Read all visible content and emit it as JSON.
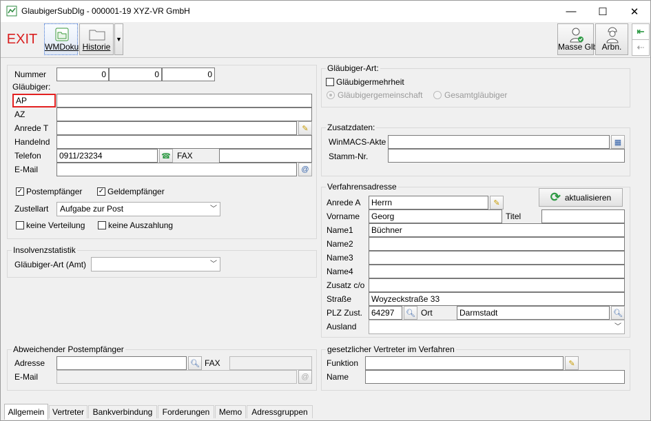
{
  "window": {
    "title": "GlaubigerSubDlg - 000001-19 XYZ-VR GmbH",
    "min": "—",
    "max": "☐",
    "close": "✕"
  },
  "toolbar": {
    "exit": "EXIT",
    "wmdoku": "WMDoku",
    "historie": "Historie",
    "masse": "Masse Glb.",
    "arbn": "Arbn."
  },
  "glaeubiger": {
    "nummer_label": "Nummer",
    "nummer": [
      "0",
      "0",
      "0"
    ],
    "group": "Gläubiger:",
    "ap_label": "AP",
    "az_label": "AZ",
    "anrede_label": "Anrede T",
    "handelnd_label": "Handelnd",
    "telefon_label": "Telefon",
    "telefon": "0911/23234",
    "fax_label": "FAX",
    "email_label": "E-Mail",
    "postempfaenger": "Postempfänger",
    "geldempfaenger": "Geldempfänger",
    "zustellart_label": "Zustellart",
    "zustellart": "Aufgabe zur Post",
    "keine_verteilung": "keine Verteilung",
    "keine_auszahlung": "keine Auszahlung"
  },
  "insolvenz": {
    "group": "Insolvenzstatistik",
    "art_label": "Gläubiger-Art (Amt)"
  },
  "abweichend": {
    "group": "Abweichender Postempfänger",
    "adresse_label": "Adresse",
    "fax_label": "FAX",
    "email_label": "E-Mail"
  },
  "art": {
    "group": "Gläubiger-Art:",
    "mehrheit": "Gläubigermehrheit",
    "gemeinschaft": "Gläubigergemeinschaft",
    "gesamt": "Gesamtgläubiger"
  },
  "zusatz": {
    "group": "Zusatzdaten:",
    "winmacs_label": "WinMACS-Akte",
    "stamm_label": "Stamm-Nr."
  },
  "verfahren": {
    "group": "Verfahrensadresse",
    "aktualisieren": "aktualisieren",
    "anrede_label": "Anrede A",
    "anrede": "Herrn",
    "vorname_label": "Vorname",
    "vorname": "Georg",
    "titel_label": "Titel",
    "name1_label": "Name1",
    "name1": "Büchner",
    "name2_label": "Name2",
    "name3_label": "Name3",
    "name4_label": "Name4",
    "zusatz_label": "Zusatz  c/o",
    "strasse_label": "Straße",
    "strasse": "Woyzeckstraße 33",
    "plz_label": "PLZ Zust.",
    "plz": "64297",
    "ort_label": "Ort",
    "ort": "Darmstadt",
    "ausland_label": "Ausland"
  },
  "vertreter": {
    "group": "gesetzlicher Vertreter im Verfahren",
    "funktion_label": "Funktion",
    "name_label": "Name"
  },
  "tabs": [
    "Allgemein",
    "Vertreter",
    "Bankverbindung",
    "Forderungen",
    "Memo",
    "Adressgruppen"
  ]
}
